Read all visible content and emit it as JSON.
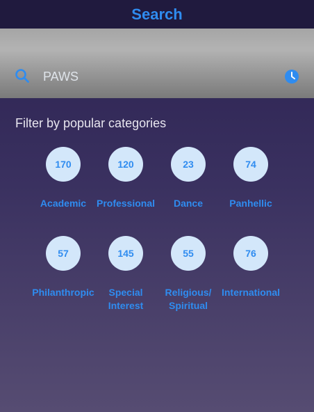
{
  "header": {
    "title": "Search"
  },
  "search": {
    "value": "PAWS",
    "icon": "search-icon",
    "history_icon": "clock-icon"
  },
  "filter": {
    "heading": "Filter by popular categories",
    "categories": [
      {
        "count": "170",
        "label": "Academic"
      },
      {
        "count": "120",
        "label": "Professional"
      },
      {
        "count": "23",
        "label": "Dance"
      },
      {
        "count": "74",
        "label": "Panhellic"
      },
      {
        "count": "57",
        "label": "Philanthropic"
      },
      {
        "count": "145",
        "label": "Special\nInterest"
      },
      {
        "count": "55",
        "label": "Religious/\nSpiritual"
      },
      {
        "count": "76",
        "label": "International"
      }
    ]
  },
  "colors": {
    "accent": "#2f8cf0",
    "header_bg": "#201a3e",
    "badge_bg": "#d3e7fa"
  }
}
